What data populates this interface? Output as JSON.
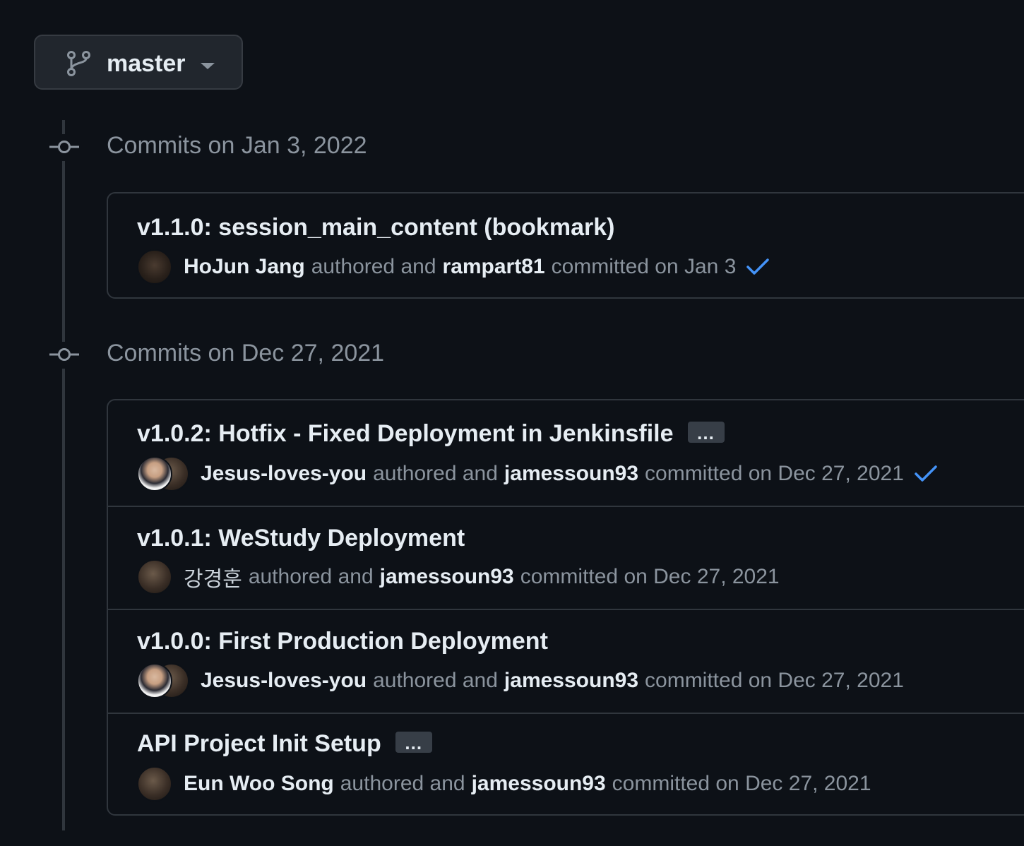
{
  "branch": {
    "name": "master",
    "icon": "git-branch-icon"
  },
  "groups": [
    {
      "heading": "Commits on Jan 3, 2022",
      "commits": [
        {
          "title": "v1.1.0: session_main_content (bookmark)",
          "author": "HoJun Jang",
          "authored_text": "authored and",
          "committer": "rampart81",
          "committed_text": "committed on Jan 3",
          "verified": true
        }
      ]
    },
    {
      "heading": "Commits on Dec 27, 2021",
      "commits": [
        {
          "title": "v1.0.2: Hotfix - Fixed Deployment in Jenkinsfile",
          "ellipsis": "…",
          "author": "Jesus-loves-you",
          "authored_text": "authored and",
          "committer": "jamessoun93",
          "committed_text": "committed on Dec 27, 2021",
          "verified": true
        },
        {
          "title": "v1.0.1: WeStudy Deployment",
          "author": "강경훈",
          "authored_text": "authored and",
          "committer": "jamessoun93",
          "committed_text": "committed on Dec 27, 2021",
          "verified": false
        },
        {
          "title": "v1.0.0: First Production Deployment",
          "author": "Jesus-loves-you",
          "authored_text": "authored and",
          "committer": "jamessoun93",
          "committed_text": "committed on Dec 27, 2021",
          "verified": false
        },
        {
          "title": "API Project Init Setup",
          "ellipsis": "…",
          "author": "Eun Woo Song",
          "authored_text": "authored and",
          "committer": "jamessoun93",
          "committed_text": "committed on Dec 27, 2021",
          "verified": false
        }
      ]
    }
  ],
  "colors": {
    "background": "#0d1117",
    "border": "#30363d",
    "muted_text": "#8b949e",
    "primary_text": "#e6edf3",
    "verified_check": "#4493f8"
  }
}
